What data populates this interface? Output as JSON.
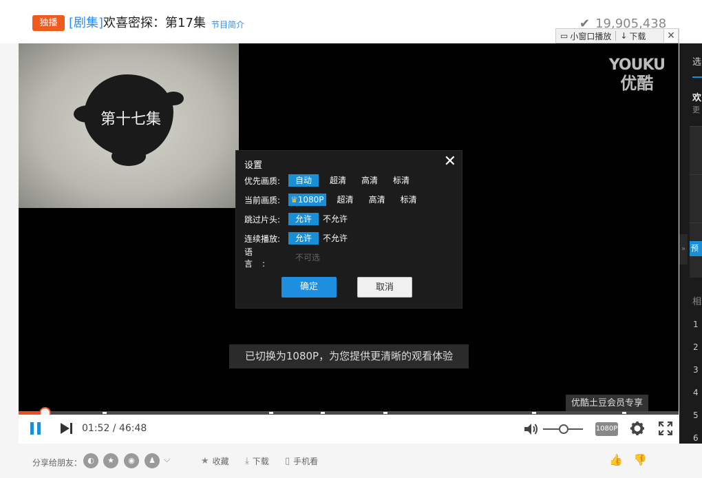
{
  "header": {
    "badge": "独播",
    "title_prefix": "[剧集]",
    "title": "欢喜密探：第17集",
    "intro_link": "节目简介",
    "view_count": "19,905,438",
    "mini_window_label": "小窗口播放",
    "download_label": "下载"
  },
  "video": {
    "episode_text": "第十七集",
    "logo_en": "YOUKU",
    "logo_cn": "优酷"
  },
  "settings": {
    "title": "设置",
    "rows": [
      {
        "label": "优先画质:",
        "options": [
          "自动",
          "超清",
          "高清",
          "标清"
        ],
        "selected": 0
      },
      {
        "label": "当前画质:",
        "options": [
          "1080P",
          "超清",
          "高清",
          "标清"
        ],
        "selected": 0
      },
      {
        "label": "跳过片头:",
        "options": [
          "允许",
          "不允许"
        ],
        "selected": 0
      },
      {
        "label": "连续播放:",
        "options": [
          "允许",
          "不允许"
        ],
        "selected": 0
      }
    ],
    "language_label": "语言:",
    "language_value": "不可选",
    "ok_label": "确定",
    "cancel_label": "取消"
  },
  "toast": "已切换为1080P，为您提供更清晰的观看体验",
  "vip_tip": "优酷土豆会员专享",
  "player": {
    "current_time": "01:52",
    "total_time": "46:48",
    "quality": "1080P",
    "progress_fraction": 0.04,
    "volume_fraction": 0.5,
    "accent_color": "#ef4d1e",
    "active_color": "#1a8fd6"
  },
  "sidebar": {
    "tab_label": "选",
    "current_title": "欢",
    "current_sub": "更",
    "preview_badge": "预",
    "related_label": "相",
    "numbers": [
      "1",
      "2",
      "3",
      "4",
      "5",
      "6"
    ]
  },
  "sharebar": {
    "share_label": "分享给朋友：",
    "favorite_label": "收藏",
    "download_label": "下载",
    "mobile_label": "手机看"
  }
}
